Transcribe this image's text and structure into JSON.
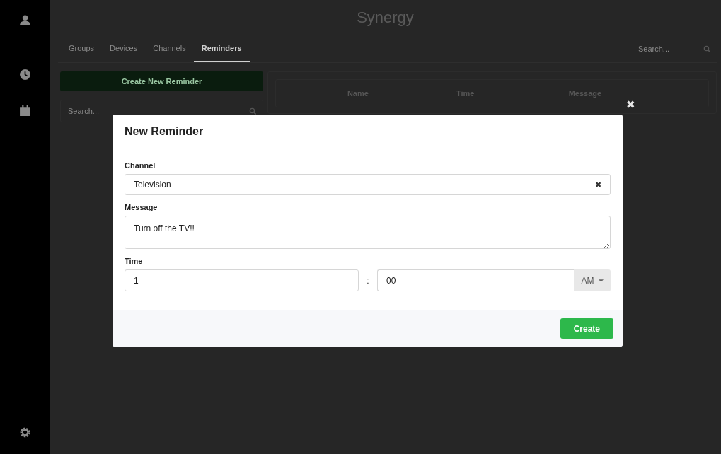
{
  "app": {
    "title": "Synergy"
  },
  "tabs": [
    {
      "label": "Groups",
      "selected": false
    },
    {
      "label": "Devices",
      "selected": false
    },
    {
      "label": "Channels",
      "selected": false
    },
    {
      "label": "Reminders",
      "selected": true
    }
  ],
  "top_search": {
    "placeholder": "Search..."
  },
  "create_button": "Create New Reminder",
  "list_search": {
    "placeholder": "Search..."
  },
  "table": {
    "columns": [
      "Name",
      "Time",
      "Message"
    ]
  },
  "modal": {
    "title": "New Reminder",
    "close": "✖",
    "channel": {
      "label": "Channel",
      "value": "Television",
      "clear": "✖"
    },
    "message": {
      "label": "Message",
      "value": "Turn off the TV!!"
    },
    "time": {
      "label": "Time",
      "hour": "1",
      "separator": ":",
      "minute": "00",
      "period": "AM"
    },
    "submit": "Create"
  }
}
